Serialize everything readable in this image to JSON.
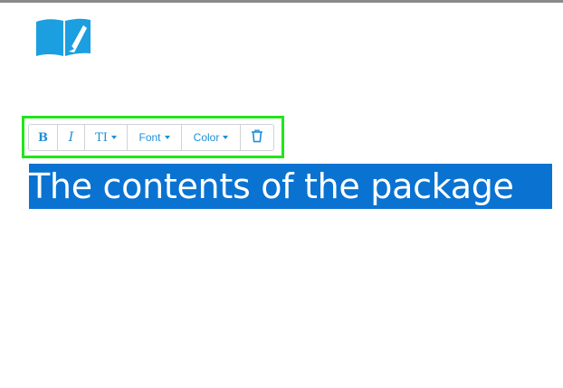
{
  "toolbar": {
    "bold_label": "B",
    "italic_label": "I",
    "text_size_label": "TI",
    "font_label": "Font",
    "color_label": "Color"
  },
  "editor": {
    "selected_text": "The contents of the package"
  },
  "colors": {
    "accent": "#1f8fd6",
    "selection": "#0a73d1",
    "highlight_outline": "#22e51b",
    "logo": "#1b9fe0"
  },
  "icons": {
    "logo": "book-pencil-icon",
    "delete": "trash-icon"
  }
}
